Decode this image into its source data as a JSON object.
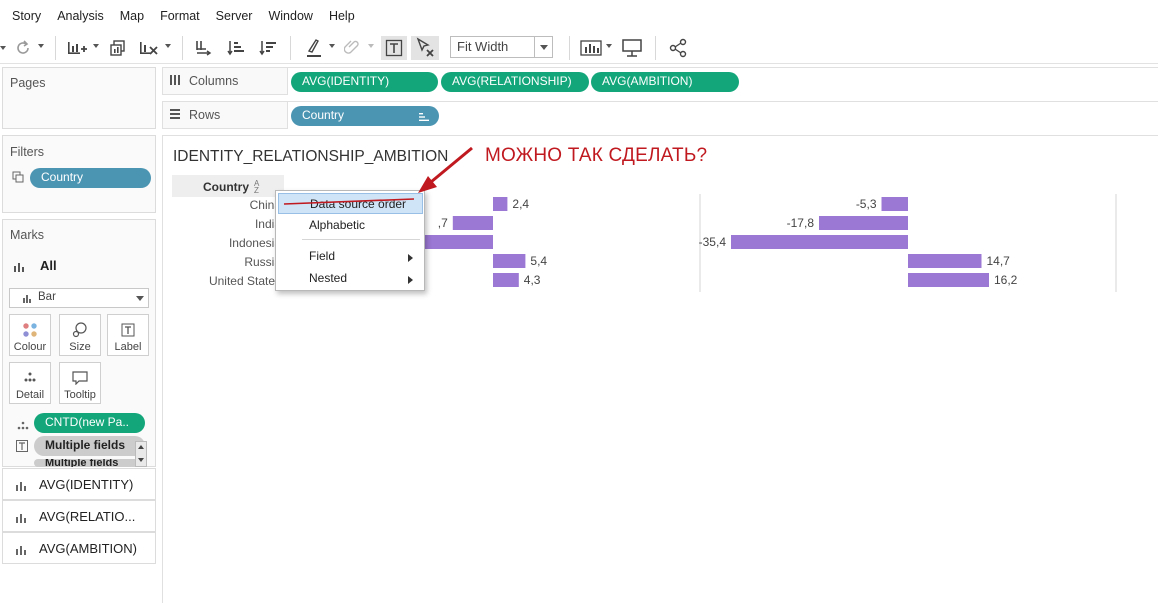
{
  "menubar": {
    "items": [
      "Story",
      "Analysis",
      "Map",
      "Format",
      "Server",
      "Window",
      "Help"
    ]
  },
  "toolbar": {
    "fit_value": "Fit Width"
  },
  "pages_panel": {
    "title": "Pages"
  },
  "filters_panel": {
    "title": "Filters",
    "pills": [
      "Country"
    ]
  },
  "marks_panel": {
    "title": "Marks",
    "all_label": "All",
    "mark_type": "Bar",
    "buttons": [
      "Colour",
      "Size",
      "Label",
      "Detail",
      "Tooltip"
    ],
    "fields": [
      "CNTD(new Pa..",
      "Multiple fields",
      "Multiple fields"
    ],
    "tabs": [
      "AVG(IDENTITY)",
      "AVG(RELATIO...",
      "AVG(AMBITION)"
    ]
  },
  "shelves": {
    "columns_label": "Columns",
    "columns": [
      "AVG(IDENTITY)",
      "AVG(RELATIONSHIP)",
      "AVG(AMBITION)"
    ],
    "rows_label": "Rows",
    "rows": [
      "Country"
    ]
  },
  "view": {
    "title": "IDENTITY_RELATIONSHIP_AMBITION",
    "annotation": "МОЖНО ТАК СДЕЛАТЬ?",
    "header": "Country"
  },
  "context_menu": {
    "items": [
      "Data source order",
      "Alphabetic",
      "Field",
      "Nested"
    ],
    "highlighted": "Data source order"
  },
  "chart_data": {
    "type": "bar",
    "categories": [
      "China",
      "India",
      "Indonesia",
      "Russia",
      "United States"
    ],
    "row_labels": [
      "China",
      "India",
      "Indonesia",
      "Russia",
      "United States"
    ],
    "bar_color": "#9b78d4",
    "panes": [
      {
        "measure": "AVG(IDENTITY)",
        "values": [
          null,
          null,
          null,
          null,
          null
        ]
      },
      {
        "measure": "AVG(RELATIONSHIP)",
        "values": [
          2.4,
          -6.7,
          -13.3,
          5.4,
          4.3
        ],
        "labels": [
          "2,4",
          ",7",
          "",
          "5,4",
          "4,3"
        ]
      },
      {
        "measure": "AVG(AMBITION)",
        "values": [
          -5.3,
          -17.8,
          -35.4,
          14.7,
          16.2
        ],
        "labels": [
          "-5,3",
          "-17,8",
          "-35,4",
          "14,7",
          "16,2"
        ]
      }
    ]
  }
}
